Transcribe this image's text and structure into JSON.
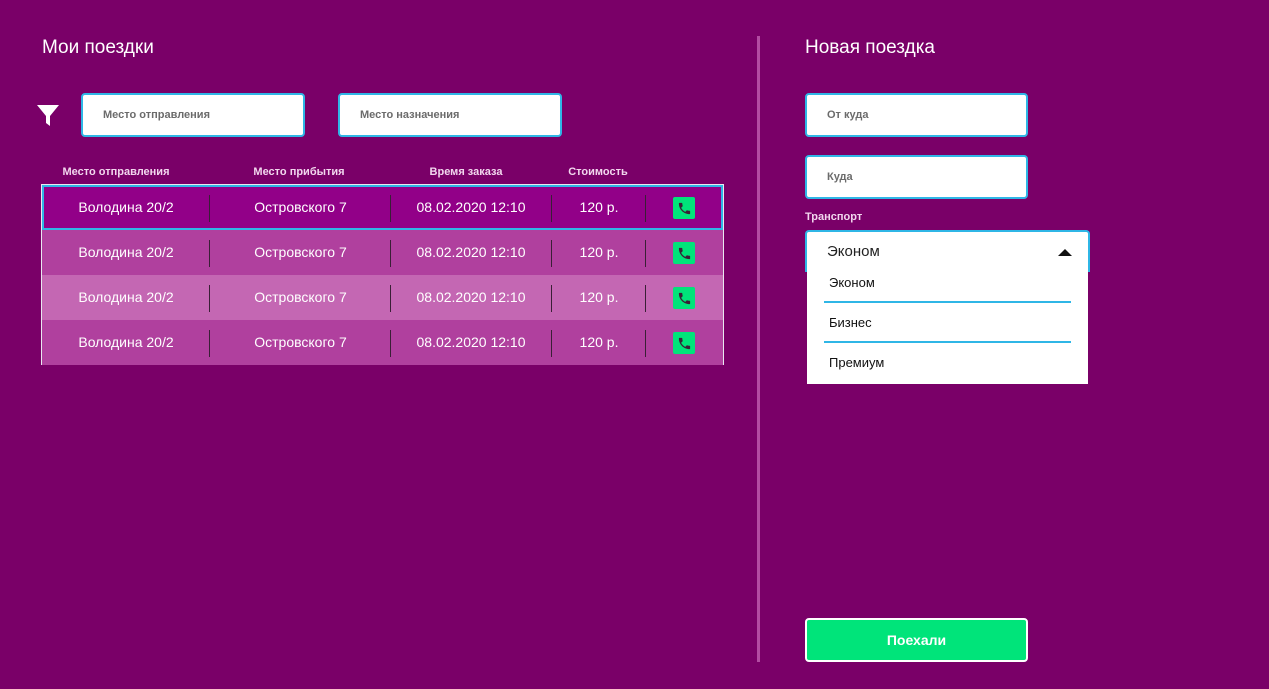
{
  "left_panel": {
    "title": "Мои поездки",
    "filter": {
      "icon": "filter-icon",
      "from_placeholder": "Место отправления",
      "to_placeholder": "Место назначения"
    },
    "table": {
      "headers": [
        "Место отправления",
        "Место прибытия",
        "Время заказа",
        "Стоимость"
      ],
      "rows": [
        {
          "from": "Володина 20/2",
          "to": "Островского 7",
          "time": "08.02.2020 12:10",
          "price": "120 р.",
          "bg": "#920088"
        },
        {
          "from": "Володина 20/2",
          "to": "Островского 7",
          "time": "08.02.2020 12:10",
          "price": "120 р.",
          "bg": "#b0409e"
        },
        {
          "from": "Володина 20/2",
          "to": "Островского 7",
          "time": "08.02.2020 12:10",
          "price": "120 р.",
          "bg": "#c467b3"
        },
        {
          "from": "Володина 20/2",
          "to": "Островского 7",
          "time": "08.02.2020 12:10",
          "price": "120 р.",
          "bg": "#b0409e"
        }
      ],
      "row_action_icon": "phone-icon"
    }
  },
  "right_panel": {
    "title": "Новая поездка",
    "from_placeholder": "От куда",
    "to_placeholder": "Куда",
    "transport_label": "Транспорт",
    "transport_selected": "Эконом",
    "transport_options": [
      "Эконом",
      "Бизнес",
      "Премиум"
    ],
    "submit_label": "Поехали"
  },
  "colors": {
    "background": "#7a0068",
    "accent_border": "#2fb6e6",
    "action_green": "#00e47a"
  }
}
